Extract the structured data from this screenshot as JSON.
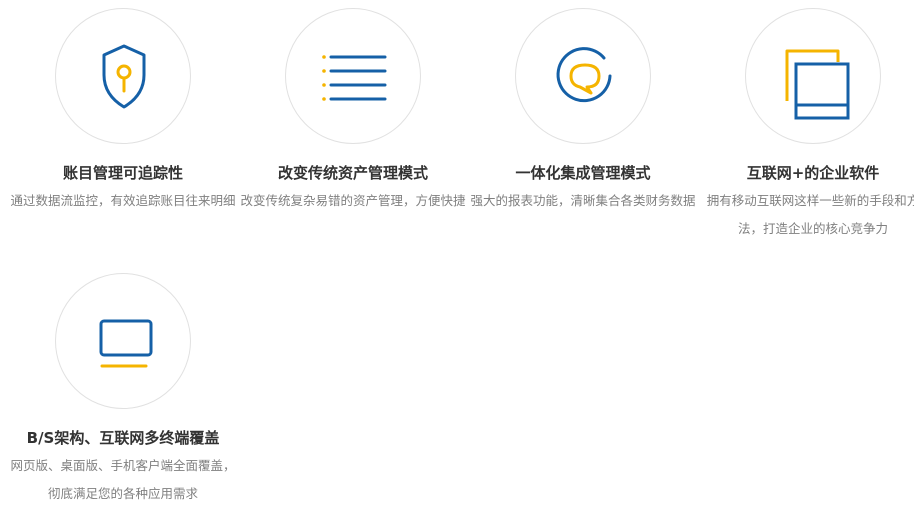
{
  "colors": {
    "blue": "#1560a7",
    "yellow": "#f5b400",
    "circle_border": "#e1e1e1",
    "title": "#333333",
    "desc": "#808080"
  },
  "features": [
    {
      "icon": "shield-key-icon",
      "title": "账目管理可追踪性",
      "desc": "通过数据流监控，有效追踪账目往来明细"
    },
    {
      "icon": "list-icon",
      "title": "改变传统资产管理模式",
      "desc": "改变传统复杂易错的资产管理，方便快捷"
    },
    {
      "icon": "chat-bubble-icon",
      "title": "一体化集成管理模式",
      "desc": "强大的报表功能，清晰集合各类财务数据"
    },
    {
      "icon": "windows-icon",
      "title": "互联网+的企业软件",
      "desc": "拥有移动互联网这样一些新的手段和方法，打造企业的核心竞争力"
    },
    {
      "icon": "monitor-icon",
      "title": "B/S架构、互联网多终端覆盖",
      "desc": "网页版、桌面版、手机客户端全面覆盖，彻底满足您的各种应用需求"
    }
  ]
}
